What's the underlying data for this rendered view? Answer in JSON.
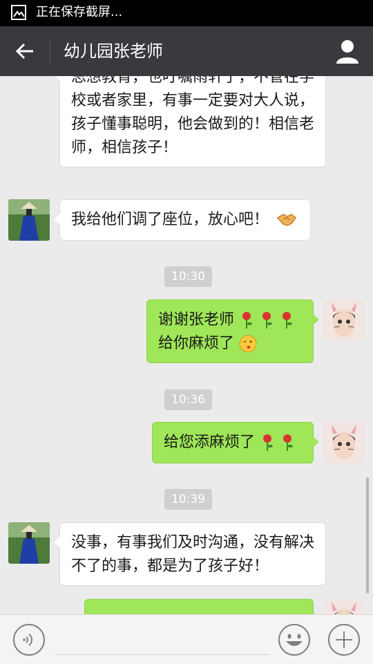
{
  "status_bar": {
    "notification": "正在保存截屏..."
  },
  "header": {
    "title": "幼儿园张老师"
  },
  "messages": [
    {
      "side": "left",
      "lines": [
        "思想教育，也叮嘱雨轩了，不管在学",
        "校或者家里，有事一定要对大人说，",
        "孩子懂事聪明，他会做到的！相信老",
        "师，相信孩子！"
      ]
    },
    {
      "side": "left",
      "text": "我给他们调了座位，放心吧！"
    },
    {
      "type": "time",
      "text": "10:30"
    },
    {
      "side": "right",
      "line1": "谢谢张老师",
      "line2": "给你麻烦了"
    },
    {
      "type": "time",
      "text": "10:36"
    },
    {
      "side": "right",
      "text": "给您添麻烦了"
    },
    {
      "type": "time",
      "text": "10:39"
    },
    {
      "side": "left",
      "lines": [
        "没事，有事我们及时沟通，没有解决",
        "不了的事，都是为了孩子好！"
      ]
    }
  ],
  "emojis": [
    "handshake",
    "rose",
    "rose",
    "rose",
    "kiss",
    "rose",
    "rose"
  ],
  "colors": {
    "bubble_self": "#9fe658",
    "bubble_other": "#ffffff",
    "title_bar": "#393a3f",
    "background": "#ebebeb"
  }
}
